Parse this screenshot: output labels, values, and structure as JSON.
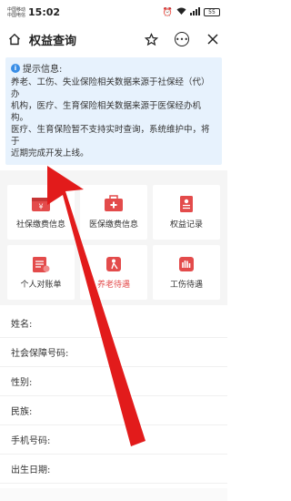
{
  "status_bar": {
    "carrier_1": "中国移动",
    "carrier_2": "中国电信",
    "time": "15:02",
    "battery": "55"
  },
  "title_bar": {
    "title": "权益查询"
  },
  "notice": {
    "heading": "提示信息:",
    "lines": [
      "养老、工伤、失业保险相关数据来源于社保经（代）办",
      "机构，医疗、生育保险相关数据来源于医保经办机构。",
      "医疗、生育保险暂不支持实时查询，系统维护中，将于",
      "近期完成开发上线。"
    ]
  },
  "tiles": [
    {
      "label": "社保缴费信息",
      "icon": "wallet-yuan-icon"
    },
    {
      "label": "医保缴费信息",
      "icon": "medical-kit-icon"
    },
    {
      "label": "权益记录",
      "icon": "document-record-icon"
    },
    {
      "label": "个人对账单",
      "icon": "statement-icon"
    },
    {
      "label": "养老待遇",
      "icon": "elderly-icon"
    },
    {
      "label": "工伤待遇",
      "icon": "hand-injury-icon"
    }
  ],
  "info_fields": [
    "姓名:",
    "社会保障号码:",
    "性别:",
    "民族:",
    "手机号码:",
    "出生日期:"
  ],
  "colors": {
    "accent_red": "#e34b4b",
    "notice_bg": "#e7f2fd",
    "info_blue": "#3a8ee6"
  }
}
